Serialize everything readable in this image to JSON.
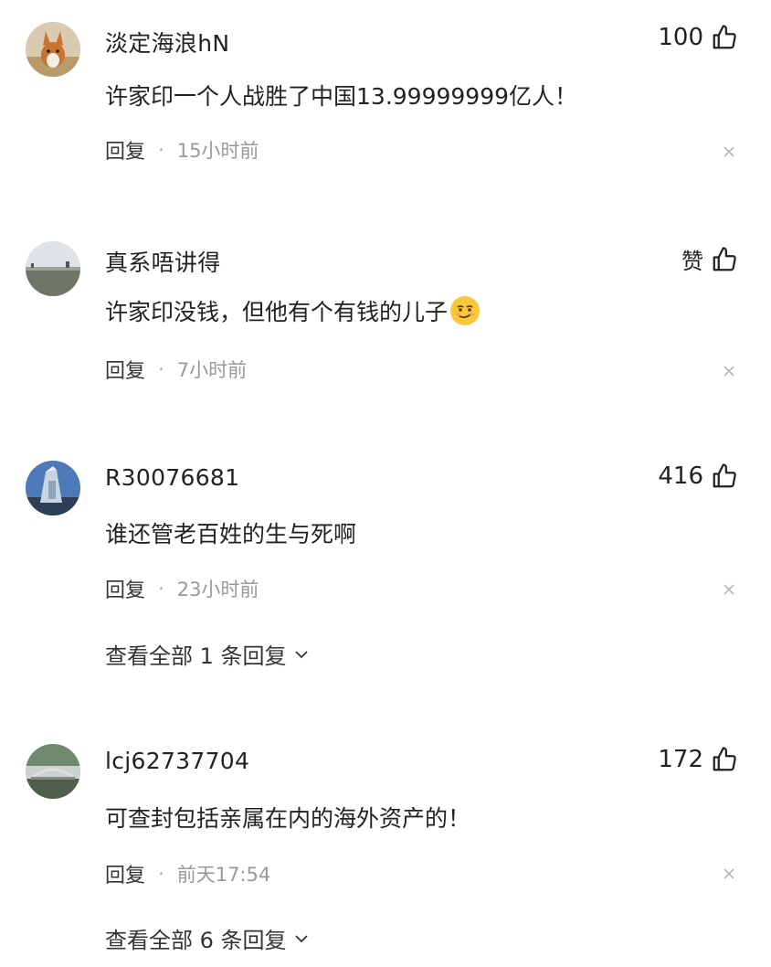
{
  "comments": [
    {
      "username": "淡定海浪hN",
      "likes": "100",
      "text": "许家印一个人战胜了中国13.99999999亿人！",
      "reply_label": "回复",
      "separator": "·",
      "time": "15小时前",
      "avatar_icon": "corgi-dog-avatar"
    },
    {
      "username": "真系唔讲得",
      "likes": "赞",
      "text": "许家印没钱，但他有个有钱的儿子",
      "emoji_icon": "smirk-emoji",
      "reply_label": "回复",
      "separator": "·",
      "time": "7小时前",
      "avatar_icon": "landscape-avatar"
    },
    {
      "username": "R30076681",
      "likes": "416",
      "text": "谁还管老百姓的生与死啊",
      "reply_label": "回复",
      "separator": "·",
      "time": "23小时前",
      "view_all": "查看全部 1 条回复",
      "avatar_icon": "building-avatar"
    },
    {
      "username": "lcj62737704",
      "likes": "172",
      "text": "可查封包括亲属在内的海外资产的！",
      "reply_label": "回复",
      "separator": "·",
      "time": "前天17:54",
      "view_all": "查看全部 6 条回复",
      "avatar_icon": "bridge-avatar"
    }
  ],
  "icons": {
    "like": "thumbs-up-icon",
    "close": "close-icon",
    "expand": "chevron-down-icon"
  },
  "colors": {
    "text": "#222222",
    "meta": "#999999",
    "close": "#b0b0b0"
  }
}
